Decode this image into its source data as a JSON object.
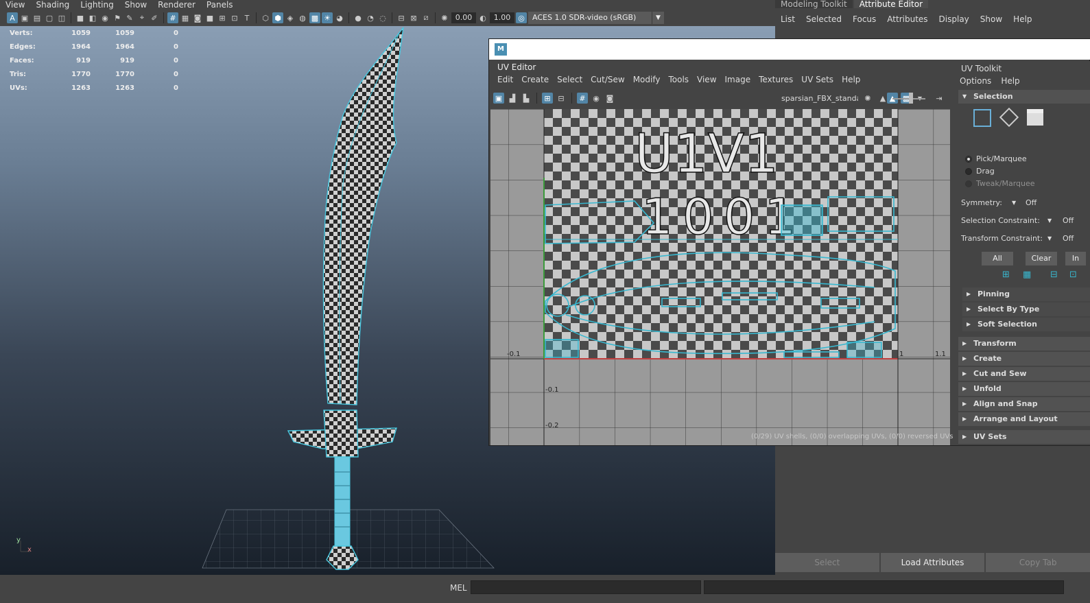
{
  "viewport": {
    "menu": [
      "View",
      "Shading",
      "Lighting",
      "Show",
      "Renderer",
      "Panels"
    ],
    "exposure": "0.00",
    "gamma": "1.00",
    "color_space": "ACES 1.0 SDR-video (sRGB)",
    "axis_labels": {
      "y": "y",
      "x": "x"
    }
  },
  "hud": [
    {
      "label": "Verts:",
      "a": "1059",
      "b": "1059",
      "c": "0"
    },
    {
      "label": "Edges:",
      "a": "1964",
      "b": "1964",
      "c": "0"
    },
    {
      "label": "Faces:",
      "a": "919",
      "b": "919",
      "c": "0"
    },
    {
      "label": "Tris:",
      "a": "1770",
      "b": "1770",
      "c": "0"
    },
    {
      "label": "UVs:",
      "a": "1263",
      "b": "1263",
      "c": "0"
    }
  ],
  "right_panel": {
    "tabs": [
      "Modeling Toolkit",
      "Attribute Editor"
    ],
    "menu": [
      "List",
      "Selected",
      "Focus",
      "Attributes",
      "Display",
      "Show",
      "Help"
    ],
    "bottom_buttons": [
      "Select",
      "Load Attributes",
      "Copy Tab"
    ]
  },
  "uv_editor": {
    "caption": "UV Editor",
    "logo": "M",
    "menu": [
      "Edit",
      "Create",
      "Select",
      "Cut/Sew",
      "Modify",
      "Tools",
      "View",
      "Image",
      "Textures",
      "UV Sets",
      "Help"
    ],
    "texture_name": "sparsian_FBX_standard",
    "tile_text_1": "U1V1",
    "tile_text_2": "1001",
    "axis_labels": {
      "x_neg": "-0.1",
      "x_one": "1",
      "x_max": "1.1",
      "y_neg1": "-0.1",
      "y_neg2": "-0.2"
    },
    "status": "(0/29) UV shells, (0/0) overlapping UVs, (0/0) reversed UVs"
  },
  "uv_toolkit": {
    "caption": "UV Toolkit",
    "menu": [
      "Options",
      "Help"
    ],
    "selection_header": "Selection",
    "modes": [
      "Pick/Marquee",
      "Drag",
      "Tweak/Marquee"
    ],
    "symmetry_label": "Symmetry:",
    "symmetry_value": "Off",
    "selection_constraint_label": "Selection Constraint:",
    "selection_constraint_value": "Off",
    "transform_constraint_label": "Transform Constraint:",
    "transform_constraint_value": "Off",
    "buttons": [
      "All",
      "Clear",
      "In"
    ],
    "subsections": [
      "Pinning",
      "Select By Type",
      "Soft Selection"
    ],
    "sections": [
      "Transform",
      "Create",
      "Cut and Sew",
      "Unfold",
      "Align and Snap",
      "Arrange and Layout",
      "UV Sets"
    ]
  },
  "command_line": {
    "label": "MEL"
  },
  "colors": {
    "accent": "#5285a6",
    "uv_shell": "#38b8d0"
  }
}
